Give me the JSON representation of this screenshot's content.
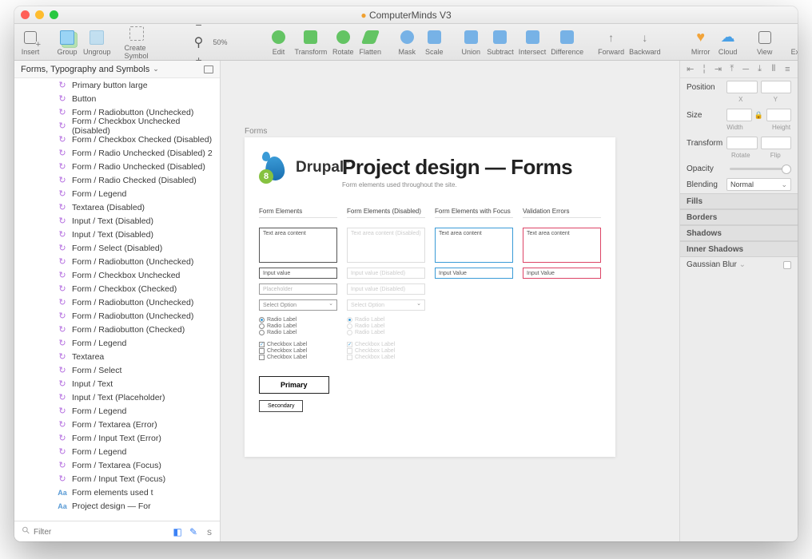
{
  "window_title": "ComputerMinds V3",
  "toolbar": {
    "insert": "Insert",
    "group": "Group",
    "ungroup": "Ungroup",
    "create_symbol": "Create Symbol",
    "zoom": "50%",
    "edit": "Edit",
    "transform": "Transform",
    "rotate": "Rotate",
    "flatten": "Flatten",
    "mask": "Mask",
    "scale": "Scale",
    "union": "Union",
    "subtract": "Subtract",
    "intersect": "Intersect",
    "difference": "Difference",
    "forward": "Forward",
    "backward": "Backward",
    "mirror": "Mirror",
    "cloud": "Cloud",
    "view": "View",
    "export": "Export"
  },
  "pages_header": "Forms, Typography and Symbols",
  "layers": [
    {
      "t": "sym",
      "l": "Primary button large"
    },
    {
      "t": "sym",
      "l": "Button"
    },
    {
      "t": "sym",
      "l": "Form / Radiobutton (Unchecked)"
    },
    {
      "t": "sym",
      "l": "Form / Checkbox Unchecked (Disabled)"
    },
    {
      "t": "sym",
      "l": "Form / Checkbox Checked (Disabled)"
    },
    {
      "t": "sym",
      "l": "Form / Radio Unchecked (Disabled) 2"
    },
    {
      "t": "sym",
      "l": "Form / Radio Unchecked (Disabled)"
    },
    {
      "t": "sym",
      "l": "Form / Radio Checked (Disabled)"
    },
    {
      "t": "sym",
      "l": "Form / Legend"
    },
    {
      "t": "sym",
      "l": "Textarea (Disabled)"
    },
    {
      "t": "sym",
      "l": "Input / Text (Disabled)"
    },
    {
      "t": "sym",
      "l": "Input / Text (Disabled)"
    },
    {
      "t": "sym",
      "l": "Form / Select (Disabled)"
    },
    {
      "t": "sym",
      "l": "Form / Radiobutton (Unchecked)"
    },
    {
      "t": "sym",
      "l": "Form / Checkbox Unchecked"
    },
    {
      "t": "sym",
      "l": "Form / Checkbox (Checked)"
    },
    {
      "t": "sym",
      "l": "Form / Radiobutton (Unchecked)"
    },
    {
      "t": "sym",
      "l": "Form / Radiobutton (Unchecked)"
    },
    {
      "t": "sym",
      "l": "Form / Radiobutton (Checked)"
    },
    {
      "t": "sym",
      "l": "Form / Legend"
    },
    {
      "t": "sym",
      "l": "Textarea"
    },
    {
      "t": "sym",
      "l": "Form / Select"
    },
    {
      "t": "sym",
      "l": "Input / Text"
    },
    {
      "t": "sym",
      "l": "Input / Text (Placeholder)"
    },
    {
      "t": "sym",
      "l": "Form / Legend"
    },
    {
      "t": "sym",
      "l": "Form / Textarea (Error)"
    },
    {
      "t": "sym",
      "l": "Form / Input Text (Error)"
    },
    {
      "t": "sym",
      "l": "Form / Legend"
    },
    {
      "t": "sym",
      "l": "Form / Textarea (Focus)"
    },
    {
      "t": "sym",
      "l": "Form / Input Text (Focus)"
    },
    {
      "t": "txt",
      "l": "Form elements used t"
    },
    {
      "t": "txt",
      "l": "Project design — For"
    }
  ],
  "filter_placeholder": "Filter",
  "artboard": {
    "label": "Forms",
    "brand_num": "8",
    "brand_name": "Drupal",
    "title": "Project design — Forms",
    "subtitle": "Form elements used throughout the site.",
    "columns": {
      "normal": "Form Elements",
      "disabled": "Form Elements (Disabled)",
      "focus": "Form Elements with Focus",
      "error": "Validation Errors"
    },
    "text_area": "Text area content",
    "text_area_disabled": "Text area content (Disabled)",
    "input_value": "Input value",
    "input_value_disabled": "Input value (Disabled)",
    "input_value_focus": "Input Value",
    "input_value_error": "Input Value",
    "placeholder": "Placeholder",
    "select": "Select Option",
    "radio": "Radio Label",
    "checkbox": "Checkbox Label",
    "primary": "Primary",
    "secondary": "Secondary"
  },
  "inspector": {
    "position": "Position",
    "x": "X",
    "y": "Y",
    "size": "Size",
    "width": "Width",
    "height": "Height",
    "transform": "Transform",
    "rotate": "Rotate",
    "flip": "Flip",
    "opacity": "Opacity",
    "blending": "Blending",
    "blend_mode": "Normal",
    "fills": "Fills",
    "borders": "Borders",
    "shadows": "Shadows",
    "inner_shadows": "Inner Shadows",
    "gaussian": "Gaussian Blur"
  }
}
